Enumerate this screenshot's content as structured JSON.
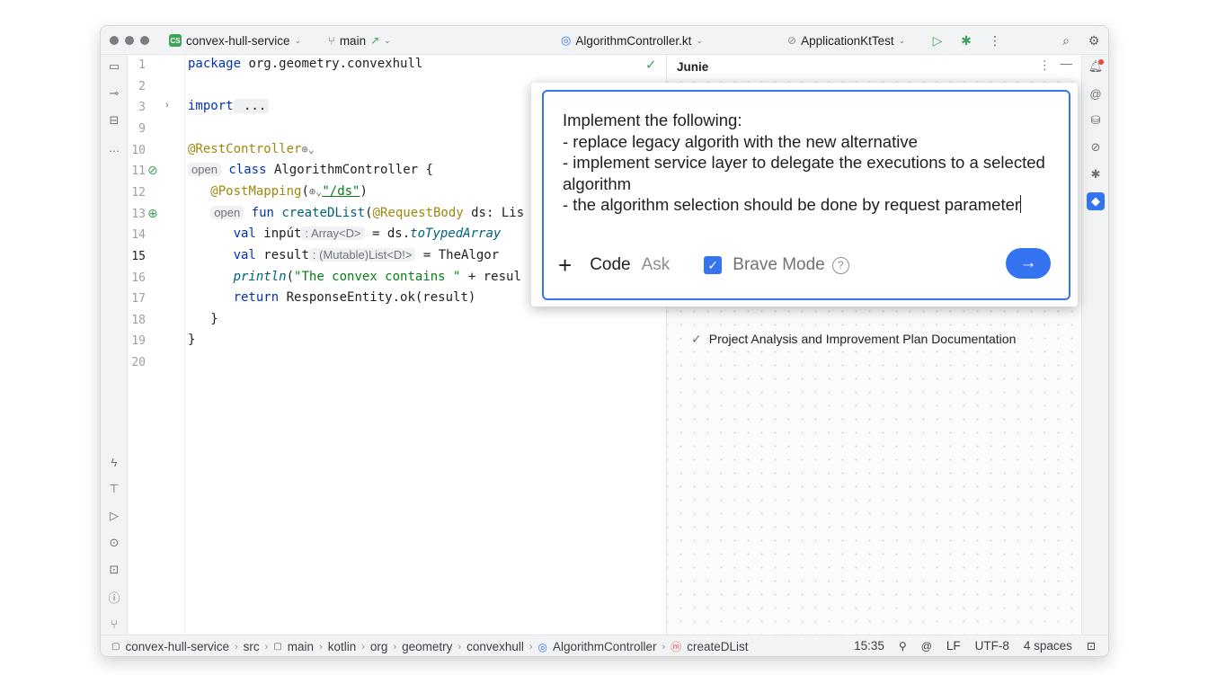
{
  "titlebar": {
    "project_badge": "CS",
    "project_name": "convex-hull-service",
    "branch": "main",
    "branch_arrow": "↗",
    "file_name": "AlgorithmController.kt",
    "run_config": "ApplicationKtTest"
  },
  "editor": {
    "line_numbers": [
      "1",
      "2",
      "3",
      "9",
      "10",
      "11",
      "12",
      "13",
      "14",
      "15",
      "16",
      "17",
      "18",
      "19",
      "20"
    ],
    "current_line": "15",
    "l1": {
      "kw": "package",
      "rest": " org.geometry.convexhull"
    },
    "l3": {
      "kw": "import",
      "rest": " ..."
    },
    "l10": {
      "ann": "@RestController"
    },
    "l11": {
      "open": "open",
      "kw": "class",
      "rest": " AlgorithmController {"
    },
    "l12": {
      "ann": "@PostMapping",
      "paren": "(",
      "str": "\"/ds\"",
      "close": ")"
    },
    "l13": {
      "open": "open",
      "kw": "fun",
      "name": " createDList",
      "rest": "(",
      "ann": "@RequestBody",
      "rest2": " ds: Lis"
    },
    "l14": {
      "kw": "val",
      "name": " inpút",
      "hint": ": Array<D>",
      "rest": " = ds.",
      "it": "toTypedArray"
    },
    "l15": {
      "kw": "val",
      "name": " result",
      "hint": ": (Mutable)List<D!>",
      "rest": " = TheAlgor"
    },
    "l16": {
      "it": "println",
      "rest": "(",
      "str": "\"The convex contains \"",
      "rest2": " + resul"
    },
    "l17": {
      "kw": "return",
      "rest": " ResponseEntity.ok(result)"
    },
    "l18": "}",
    "l19": "}"
  },
  "junie": {
    "title": "Junie",
    "task_item": "Project Analysis and Improvement Plan Documentation"
  },
  "prompt": {
    "text": "Implement the following:\n- replace legacy algorith with the new alternative\n- implement service layer to delegate the executions to a selected algorithm\n- the algorithm selection should be done by request parameter",
    "mode_code": "Code",
    "mode_ask": "Ask",
    "brave_mode_label": "Brave Mode",
    "brave_mode_checked": true
  },
  "statusbar": {
    "crumbs": [
      "convex-hull-service",
      "src",
      "main",
      "kotlin",
      "org",
      "geometry",
      "convexhull",
      "AlgorithmController",
      "createDList"
    ],
    "position": "15:35",
    "line_ending": "LF",
    "encoding": "UTF-8",
    "indent": "4 spaces"
  },
  "colors": {
    "accent": "#3574f0",
    "keyword": "#0033b3",
    "annotation": "#9e880d",
    "string": "#067d17",
    "project_badge": "#3fa15a"
  }
}
